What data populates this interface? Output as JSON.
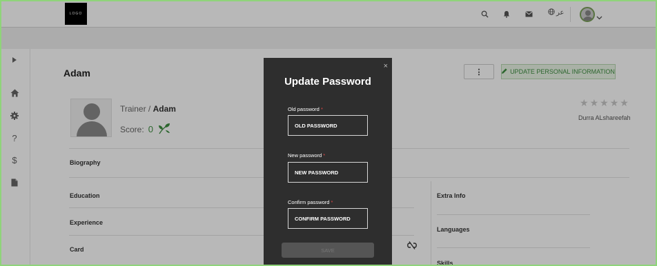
{
  "navbar": {
    "logo_text": "LOGO",
    "language_label": "عر",
    "icons": [
      "search-icon",
      "bell-icon",
      "mail-icon",
      "globe-icon",
      "chevron-down-icon"
    ]
  },
  "sidebar": {
    "icons": [
      "caret-right-icon",
      "home-icon",
      "gear-icon",
      "question-icon",
      "dollar-icon",
      "document-icon"
    ]
  },
  "profile": {
    "name": "Adam",
    "role_prefix": "Trainer / ",
    "role_name": "Adam",
    "score_label": "Score:",
    "score_value": "0",
    "reviewer": "Durra ALshareefah",
    "stars_total": 5,
    "more_button_label": "⋮",
    "update_button_label": "UPDATE PERSONAL INFORMATION"
  },
  "sections": {
    "biography": "Biography",
    "education": "Education",
    "experience": "Experience",
    "card": "Card",
    "extra_info": "Extra Info",
    "languages": "Languages",
    "skills": "Skills"
  },
  "modal": {
    "title": "Update Password",
    "close_label": "×",
    "old_label": "Old password",
    "old_placeholder": "OLD PASSWORD",
    "new_label": "New password",
    "new_placeholder": "NEW PASSWORD",
    "confirm_label": "Confirm password",
    "confirm_placeholder": "CONFIRM PASSWORD",
    "required_mark": "*",
    "save_label": "SAVE"
  },
  "colors": {
    "accent_green": "#3e8e41",
    "modal_bg": "#2e2e2e",
    "required_red": "#e04848"
  }
}
